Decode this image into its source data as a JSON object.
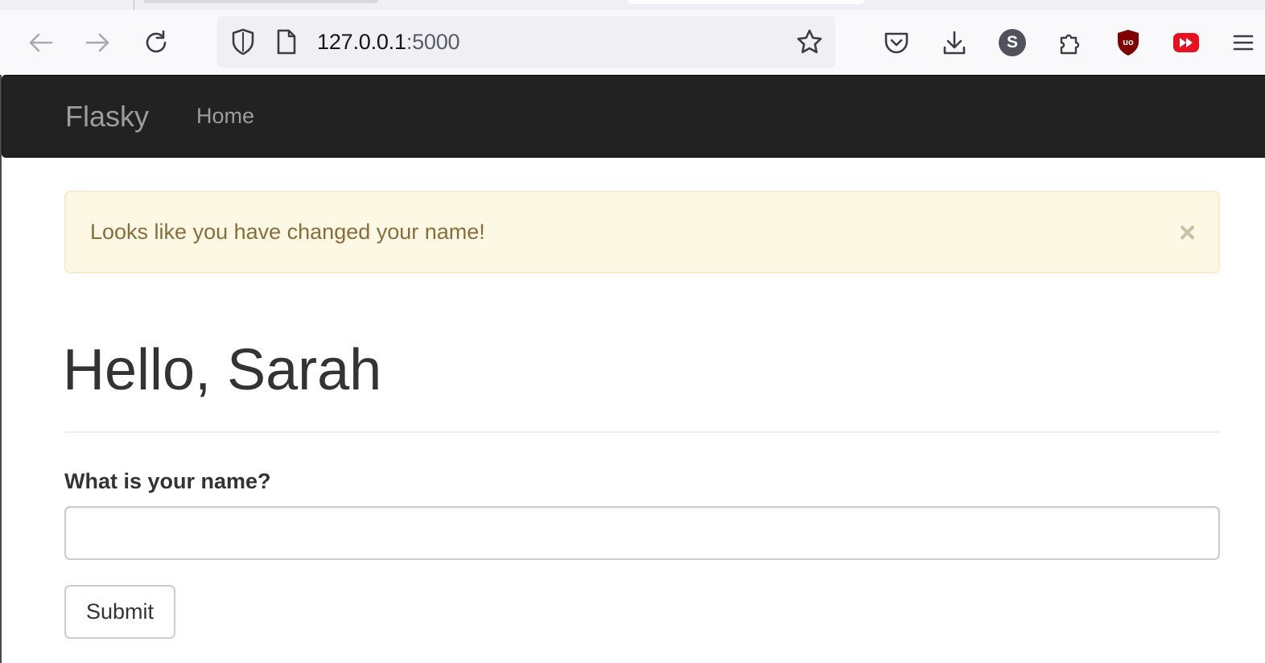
{
  "browser": {
    "url_host": "127.0.0.1",
    "url_port": ":5000",
    "profile_initial": "S",
    "ublock_text": "uo"
  },
  "navbar": {
    "brand": "Flasky",
    "home": "Home"
  },
  "alert": {
    "message": "Looks like you have changed your name!",
    "close": "×"
  },
  "main": {
    "heading": "Hello, Sarah",
    "form": {
      "label": "What is your name?",
      "input_value": "",
      "submit_label": "Submit"
    }
  },
  "colors": {
    "navbar_bg": "#222222",
    "alert_bg": "#fcf8e3",
    "alert_text": "#8a6d3b"
  }
}
